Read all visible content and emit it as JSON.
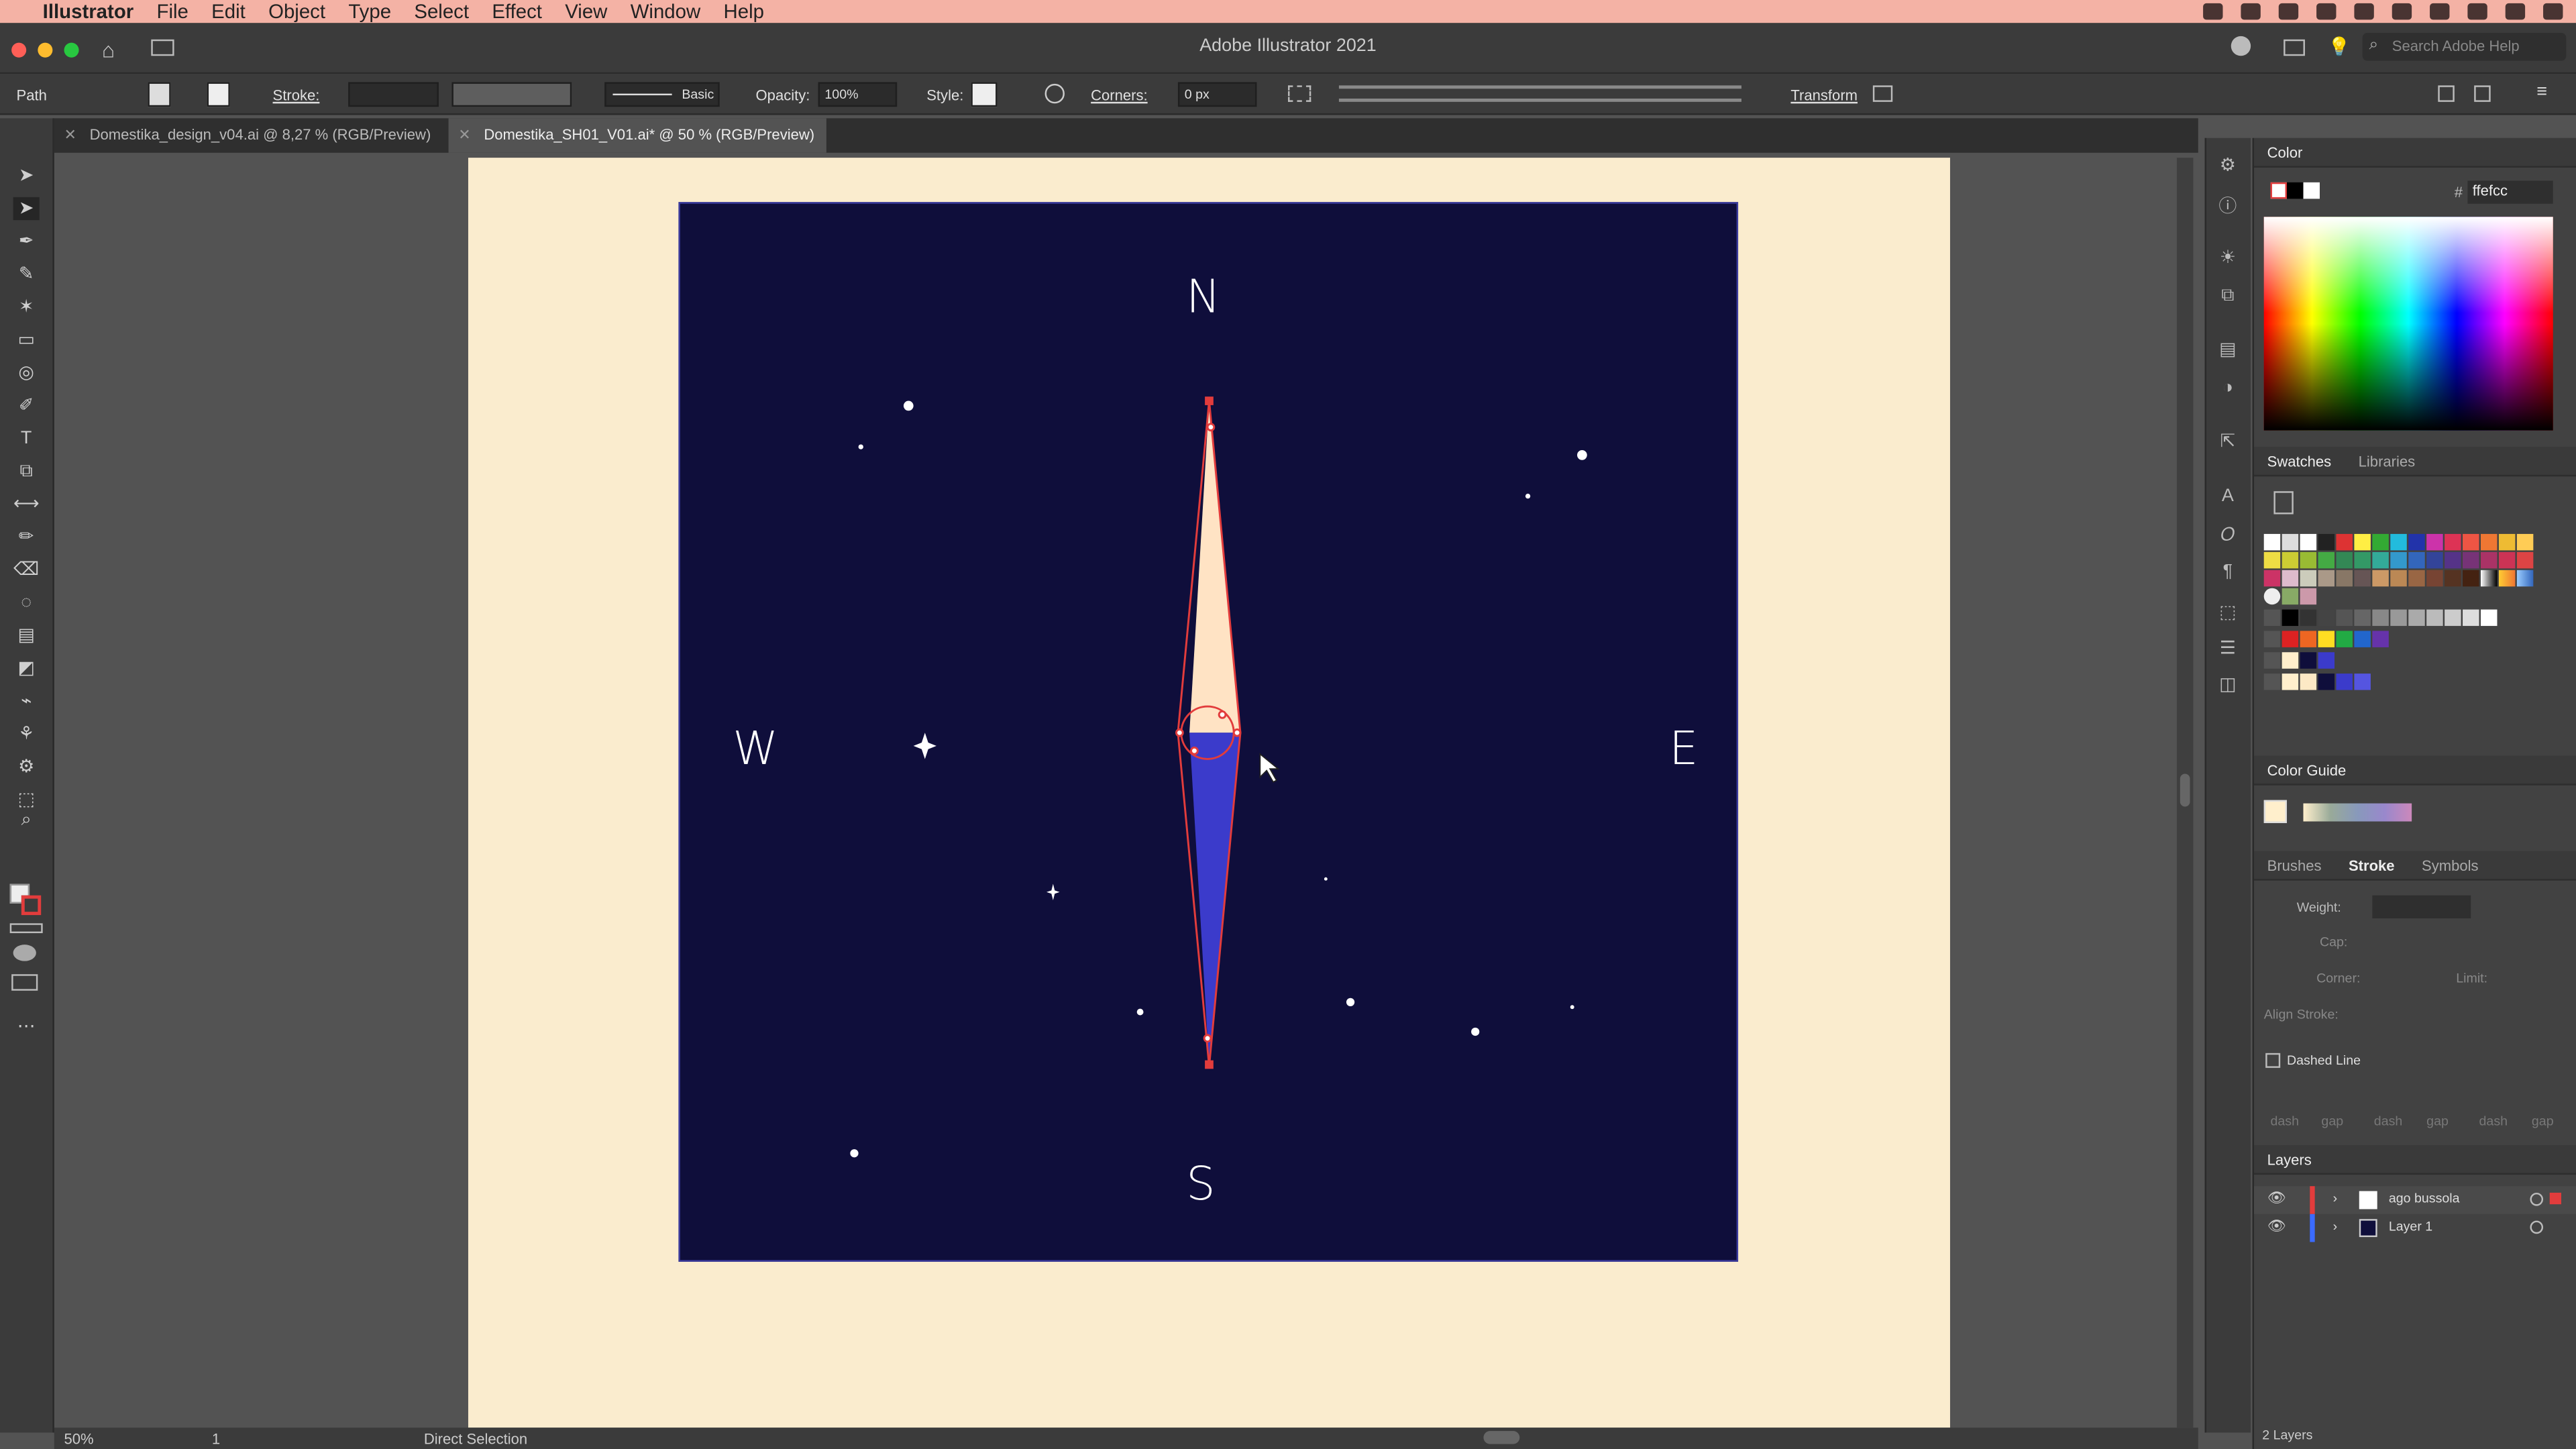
{
  "menubar": {
    "app": "Illustrator",
    "items": [
      "File",
      "Edit",
      "Object",
      "Type",
      "Select",
      "Effect",
      "View",
      "Window",
      "Help"
    ]
  },
  "window": {
    "title": "Adobe Illustrator 2021"
  },
  "search": {
    "placeholder": "Search Adobe Help"
  },
  "control": {
    "selection": "Path",
    "stroke_label": "Stroke:",
    "brush": "Basic",
    "opacity_label": "Opacity:",
    "opacity": "100%",
    "style_label": "Style:",
    "corners_label": "Corners:",
    "corners": "0 px",
    "transform": "Transform"
  },
  "tabs": [
    {
      "label": "Domestika_design_v04.ai @ 8,27 % (RGB/Preview)"
    },
    {
      "label": "Domestika_SH01_V01.ai* @ 50 % (RGB/Preview)"
    }
  ],
  "art": {
    "n": "N",
    "s": "S",
    "w": "W",
    "e": "E",
    "bg": "#0f0e3b",
    "north": "#ffe3c4",
    "south": "#3b3bcb"
  },
  "color_panel": {
    "title": "Color",
    "hex": "ffefcc"
  },
  "swatches_panel": {
    "tab1": "Swatches",
    "tab2": "Libraries"
  },
  "guide": {
    "title": "Color Guide"
  },
  "stroke_panel": {
    "tab1": "Brushes",
    "tab2": "Stroke",
    "tab3": "Symbols",
    "weight": "Weight:",
    "cap": "Cap:",
    "corner": "Corner:",
    "limit": "Limit:",
    "align": "Align Stroke:",
    "dashed": "Dashed Line",
    "dash": "dash",
    "gap": "gap"
  },
  "layers": {
    "title": "Layers",
    "items": [
      {
        "name": "ago bussola",
        "color": "#e23c3c"
      },
      {
        "name": "Layer 1",
        "color": "#3b6bff"
      }
    ],
    "count": "2 Layers"
  },
  "status": {
    "zoom": "50%",
    "page": "1",
    "tool": "Direct Selection"
  }
}
